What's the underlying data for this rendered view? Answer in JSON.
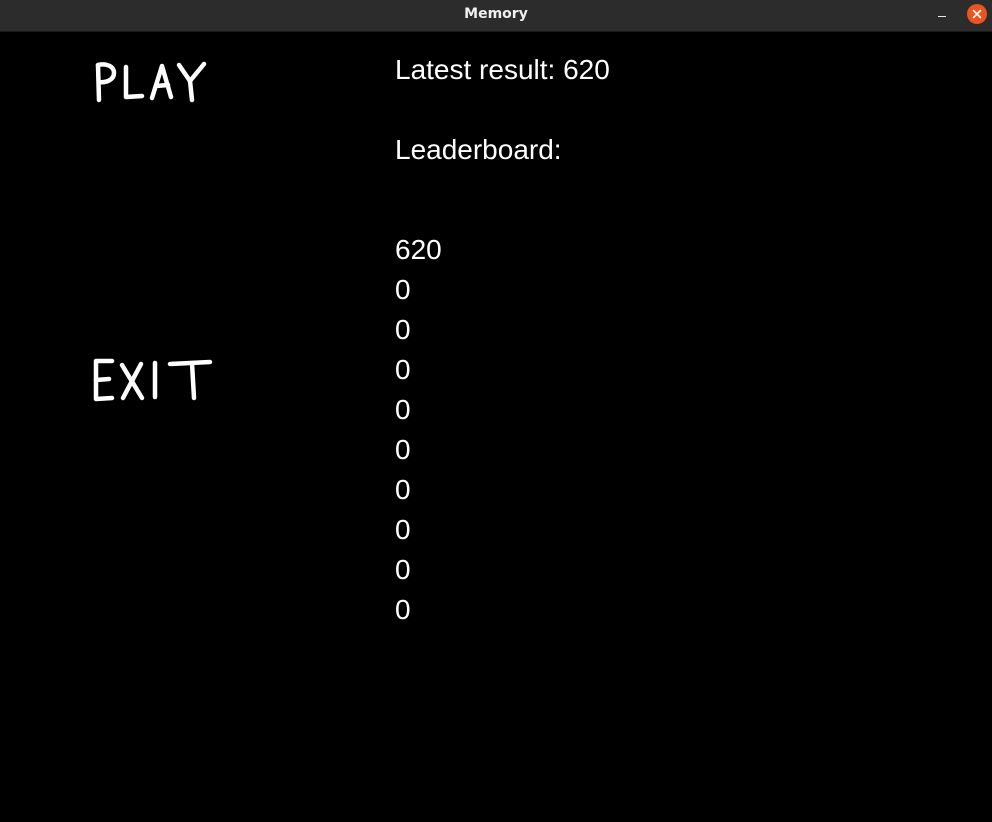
{
  "window": {
    "title": "Memory"
  },
  "menu": {
    "play_label": "PLAY",
    "exit_label": "EXIT"
  },
  "results": {
    "latest_label": "Latest result: 620",
    "leaderboard_label": "Leaderboard:",
    "leaderboard": [
      "620",
      "0",
      "0",
      "0",
      "0",
      "0",
      "0",
      "0",
      "0",
      "0"
    ]
  },
  "colors": {
    "background": "#000000",
    "text": "#ffffff",
    "titlebar": "#2c2c2c",
    "close_button": "#e95420"
  }
}
